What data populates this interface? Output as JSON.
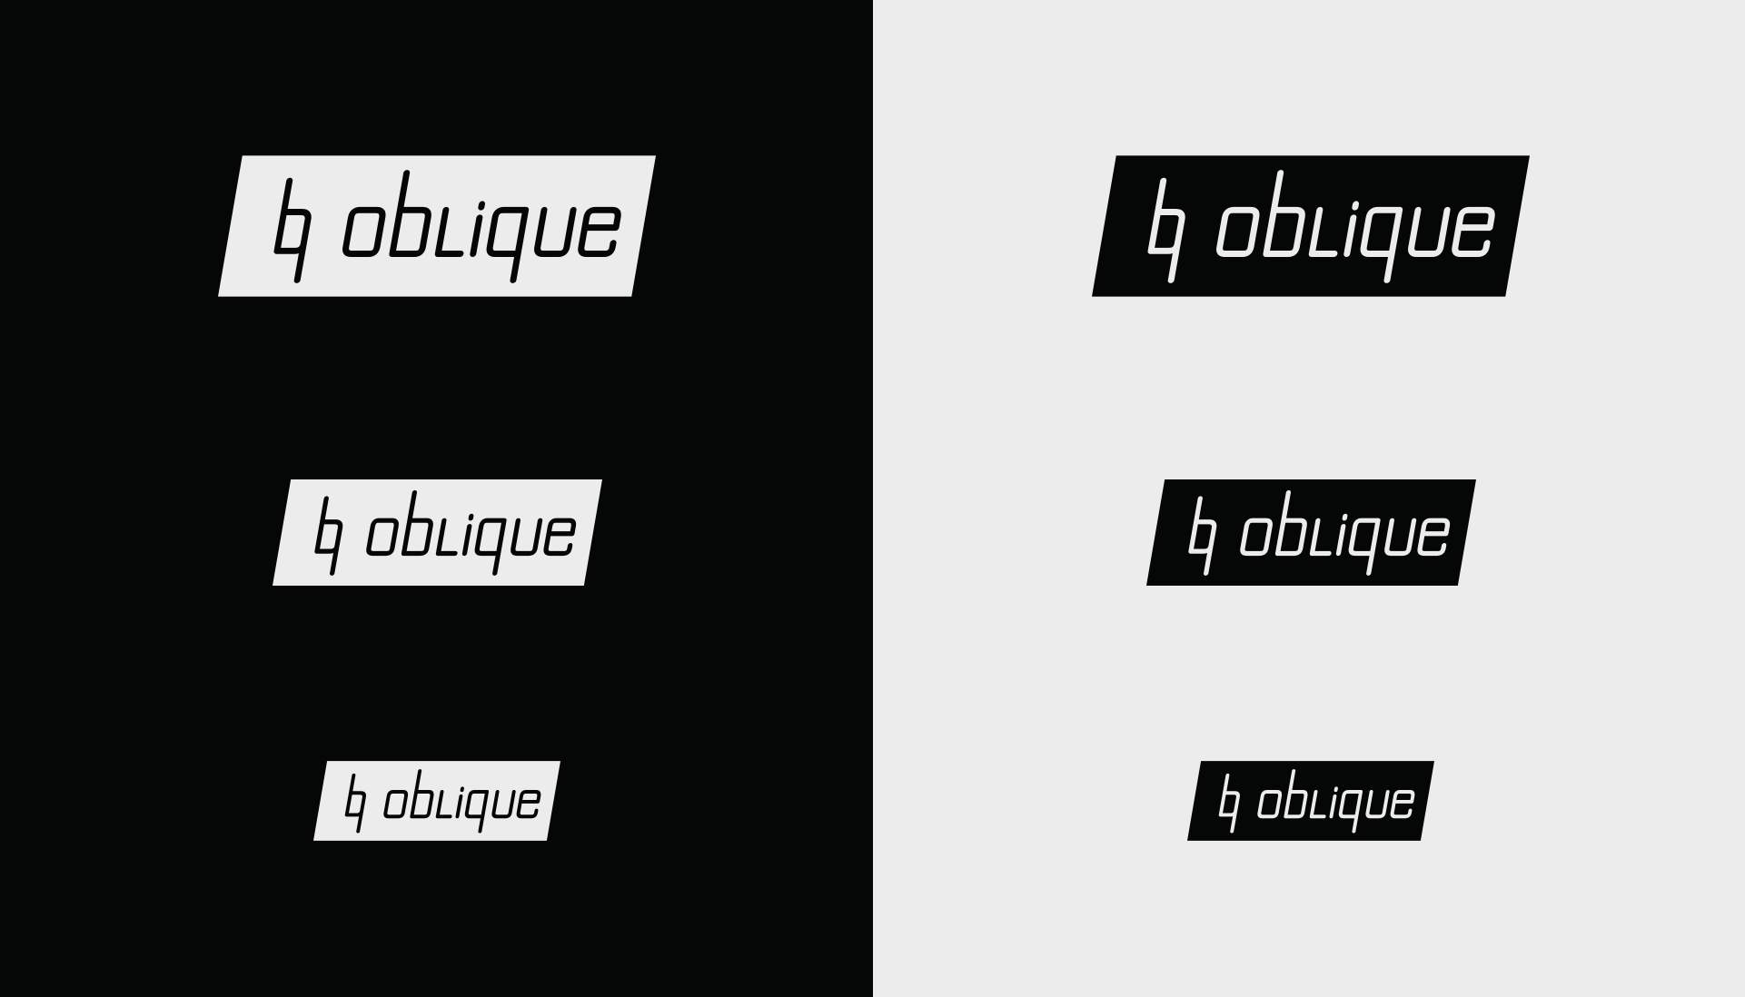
{
  "brand": {
    "mark_letters": "bq",
    "wordmark": "obLique"
  },
  "colors": {
    "dark_panel": "#050606",
    "light_panel": "#ececec",
    "badge_light": "#ececec",
    "badge_dark": "#050606"
  },
  "panels": [
    {
      "id": "dark",
      "background": "#050606",
      "badge_color": "#ececec",
      "ink_color": "#050606",
      "logos": [
        {
          "size": "large"
        },
        {
          "size": "medium"
        },
        {
          "size": "small"
        }
      ]
    },
    {
      "id": "light",
      "background": "#ececec",
      "badge_color": "#050606",
      "ink_color": "#ececec",
      "logos": [
        {
          "size": "large"
        },
        {
          "size": "medium"
        },
        {
          "size": "small"
        }
      ]
    }
  ]
}
